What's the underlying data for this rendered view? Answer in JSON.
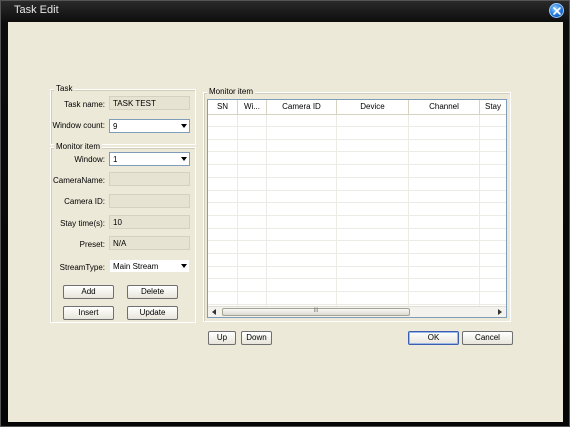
{
  "window": {
    "title": "Task Edit"
  },
  "task_group": {
    "legend": "Task",
    "task_name_label": "Task name:",
    "task_name_value": "TASK TEST",
    "window_count_label": "Window count:",
    "window_count_value": "9"
  },
  "monitor_group": {
    "legend": "Monitor item",
    "window_label": "Window:",
    "window_value": "1",
    "camera_name_label": "CameraName:",
    "camera_name_value": "",
    "camera_id_label": "Camera ID:",
    "camera_id_value": "",
    "stay_time_label": "Stay time(s):",
    "stay_time_value": "10",
    "preset_label": "Preset:",
    "preset_value": "N/A",
    "stream_type_label": "StreamType:",
    "stream_type_value": "Main Stream",
    "add_label": "Add",
    "delete_label": "Delete",
    "insert_label": "Insert",
    "update_label": "Update"
  },
  "monitor_list": {
    "legend": "Monitor item",
    "columns": [
      "SN",
      "Wi...",
      "Camera ID",
      "Device",
      "Channel",
      "Stay"
    ],
    "scroll_grip": "III"
  },
  "footer": {
    "up_label": "Up",
    "down_label": "Down",
    "ok_label": "OK",
    "cancel_label": "Cancel"
  }
}
